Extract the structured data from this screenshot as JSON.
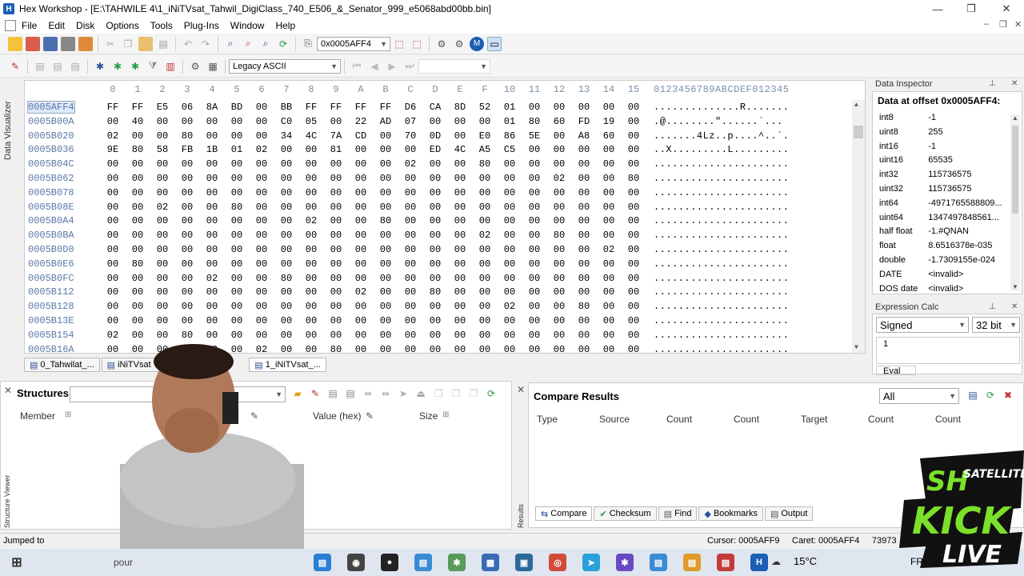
{
  "window": {
    "title": "Hex Workshop - [E:\\TAHWILE 4\\1_iNiTVsat_Tahwil_DigiClass_740_E506_&_Senator_999_e5068abd00bb.bin]",
    "minimize": "—",
    "restore": "❐",
    "close": "✕"
  },
  "menu": [
    "File",
    "Edit",
    "Disk",
    "Options",
    "Tools",
    "Plug-Ins",
    "Window",
    "Help"
  ],
  "toolbar": {
    "goto_value": "0x0005AFF4",
    "charset": "Legacy ASCII"
  },
  "sidebar_left": {
    "label": "Data Visualizer"
  },
  "hex": {
    "header": [
      "0",
      "1",
      "2",
      "3",
      "4",
      "5",
      "6",
      "7",
      "8",
      "9",
      "A",
      "B",
      "C",
      "D",
      "E",
      "F",
      "10",
      "11",
      "12",
      "13",
      "14",
      "15"
    ],
    "ascii_header": "0123456789ABCDEF012345",
    "rows": [
      {
        "offset": "0005AFF4",
        "bytes": [
          "FF",
          "FF",
          "E5",
          "06",
          "8A",
          "BD",
          "00",
          "BB",
          "FF",
          "FF",
          "FF",
          "FF",
          "D6",
          "CA",
          "8D",
          "52",
          "01",
          "00",
          "00",
          "00",
          "00",
          "00"
        ],
        "ascii": "..............R......."
      },
      {
        "offset": "0005B00A",
        "bytes": [
          "00",
          "40",
          "00",
          "00",
          "00",
          "00",
          "00",
          "C0",
          "05",
          "00",
          "22",
          "AD",
          "07",
          "00",
          "00",
          "00",
          "01",
          "80",
          "60",
          "FD",
          "19",
          "00"
        ],
        "ascii": ".@........\"......`..."
      },
      {
        "offset": "0005B020",
        "bytes": [
          "02",
          "00",
          "00",
          "80",
          "00",
          "00",
          "00",
          "34",
          "4C",
          "7A",
          "CD",
          "00",
          "70",
          "0D",
          "00",
          "E0",
          "86",
          "5E",
          "00",
          "A8",
          "60",
          "00"
        ],
        "ascii": ".......4Lz..p....^..`."
      },
      {
        "offset": "0005B036",
        "bytes": [
          "9E",
          "80",
          "58",
          "FB",
          "1B",
          "01",
          "02",
          "00",
          "00",
          "81",
          "00",
          "00",
          "00",
          "ED",
          "4C",
          "A5",
          "C5",
          "00",
          "00",
          "00",
          "00",
          "00"
        ],
        "ascii": "..X.........L........."
      },
      {
        "offset": "0005B04C",
        "bytes": [
          "00",
          "00",
          "00",
          "00",
          "00",
          "00",
          "00",
          "00",
          "00",
          "00",
          "00",
          "00",
          "02",
          "00",
          "00",
          "80",
          "00",
          "00",
          "00",
          "00",
          "00",
          "00"
        ],
        "ascii": "......................"
      },
      {
        "offset": "0005B062",
        "bytes": [
          "00",
          "00",
          "00",
          "00",
          "00",
          "00",
          "00",
          "00",
          "00",
          "00",
          "00",
          "00",
          "00",
          "00",
          "00",
          "00",
          "00",
          "00",
          "02",
          "00",
          "00",
          "80"
        ],
        "ascii": "......................"
      },
      {
        "offset": "0005B078",
        "bytes": [
          "00",
          "00",
          "00",
          "00",
          "00",
          "00",
          "00",
          "00",
          "00",
          "00",
          "00",
          "00",
          "00",
          "00",
          "00",
          "00",
          "00",
          "00",
          "00",
          "00",
          "00",
          "00"
        ],
        "ascii": "......................"
      },
      {
        "offset": "0005B08E",
        "bytes": [
          "00",
          "00",
          "02",
          "00",
          "00",
          "80",
          "00",
          "00",
          "00",
          "00",
          "00",
          "00",
          "00",
          "00",
          "00",
          "00",
          "00",
          "00",
          "00",
          "00",
          "00",
          "00"
        ],
        "ascii": "......................"
      },
      {
        "offset": "0005B0A4",
        "bytes": [
          "00",
          "00",
          "00",
          "00",
          "00",
          "00",
          "00",
          "00",
          "02",
          "00",
          "00",
          "80",
          "00",
          "00",
          "00",
          "00",
          "00",
          "00",
          "00",
          "00",
          "00",
          "00"
        ],
        "ascii": "......................"
      },
      {
        "offset": "0005B0BA",
        "bytes": [
          "00",
          "00",
          "00",
          "00",
          "00",
          "00",
          "00",
          "00",
          "00",
          "00",
          "00",
          "00",
          "00",
          "00",
          "00",
          "02",
          "00",
          "00",
          "80",
          "00",
          "00",
          "00"
        ],
        "ascii": "......................"
      },
      {
        "offset": "0005B0D0",
        "bytes": [
          "00",
          "00",
          "00",
          "00",
          "00",
          "00",
          "00",
          "00",
          "00",
          "00",
          "00",
          "00",
          "00",
          "00",
          "00",
          "00",
          "00",
          "00",
          "00",
          "00",
          "02",
          "00"
        ],
        "ascii": "......................"
      },
      {
        "offset": "0005B0E6",
        "bytes": [
          "00",
          "80",
          "00",
          "00",
          "00",
          "00",
          "00",
          "00",
          "00",
          "00",
          "00",
          "00",
          "00",
          "00",
          "00",
          "00",
          "00",
          "00",
          "00",
          "00",
          "00",
          "00"
        ],
        "ascii": "......................"
      },
      {
        "offset": "0005B0FC",
        "bytes": [
          "00",
          "00",
          "00",
          "00",
          "02",
          "00",
          "00",
          "80",
          "00",
          "00",
          "00",
          "00",
          "00",
          "00",
          "00",
          "00",
          "00",
          "00",
          "00",
          "00",
          "00",
          "00"
        ],
        "ascii": "......................"
      },
      {
        "offset": "0005B112",
        "bytes": [
          "00",
          "00",
          "00",
          "00",
          "00",
          "00",
          "00",
          "00",
          "00",
          "00",
          "02",
          "00",
          "00",
          "80",
          "00",
          "00",
          "00",
          "00",
          "00",
          "00",
          "00",
          "00"
        ],
        "ascii": "......................"
      },
      {
        "offset": "0005B128",
        "bytes": [
          "00",
          "00",
          "00",
          "00",
          "00",
          "00",
          "00",
          "00",
          "00",
          "00",
          "00",
          "00",
          "00",
          "00",
          "00",
          "00",
          "02",
          "00",
          "00",
          "80",
          "00",
          "00"
        ],
        "ascii": "......................"
      },
      {
        "offset": "0005B13E",
        "bytes": [
          "00",
          "00",
          "00",
          "00",
          "00",
          "00",
          "00",
          "00",
          "00",
          "00",
          "00",
          "00",
          "00",
          "00",
          "00",
          "00",
          "00",
          "00",
          "00",
          "00",
          "00",
          "00"
        ],
        "ascii": "......................"
      },
      {
        "offset": "0005B154",
        "bytes": [
          "02",
          "00",
          "00",
          "80",
          "00",
          "00",
          "00",
          "00",
          "00",
          "00",
          "00",
          "00",
          "00",
          "00",
          "00",
          "00",
          "00",
          "00",
          "00",
          "00",
          "00",
          "00"
        ],
        "ascii": "......................"
      },
      {
        "offset": "0005B16A",
        "bytes": [
          "00",
          "00",
          "00",
          "00",
          "00",
          "00",
          "02",
          "00",
          "00",
          "80",
          "00",
          "00",
          "00",
          "00",
          "00",
          "00",
          "00",
          "00",
          "00",
          "00",
          "00",
          "00"
        ],
        "ascii": "......................"
      }
    ]
  },
  "doc_tabs": [
    "0_Tahwilat_...",
    "iNiTVsat Ta...",
    "1_iNiTVsat_..."
  ],
  "data_inspector": {
    "title": "Data Inspector",
    "heading": "Data at offset 0x0005AFF4:",
    "rows": [
      {
        "k": "int8",
        "v": "-1"
      },
      {
        "k": "uint8",
        "v": "255"
      },
      {
        "k": "int16",
        "v": "-1"
      },
      {
        "k": "uint16",
        "v": "65535"
      },
      {
        "k": "int32",
        "v": "115736575"
      },
      {
        "k": "uint32",
        "v": "115736575"
      },
      {
        "k": "int64",
        "v": "-4971765588809..."
      },
      {
        "k": "uint64",
        "v": "1347497848561..."
      },
      {
        "k": "half float",
        "v": "-1.#QNAN"
      },
      {
        "k": "float",
        "v": "8.6516378e-035"
      },
      {
        "k": "double",
        "v": "-1.7309155e-024"
      },
      {
        "k": "DATE",
        "v": "<invalid>"
      },
      {
        "k": "DOS date",
        "v": "<invalid>"
      }
    ]
  },
  "expression_calc": {
    "title": "Expression Calc",
    "signed": "Signed",
    "bits": "32 bit",
    "line": "1",
    "eval_label": "Eval"
  },
  "structures": {
    "title": "Structures",
    "columns": [
      "Member",
      "Value (hex)",
      "Size"
    ],
    "side_label": "Structure Viewer"
  },
  "compare": {
    "title": "Compare Results",
    "filter": "All",
    "columns": [
      "Type",
      "Source",
      "Count",
      "Count",
      "Target",
      "Count",
      "Count"
    ],
    "tabs": [
      "Compare",
      "Checksum",
      "Find",
      "Bookmarks",
      "Output"
    ],
    "side_label": "Results"
  },
  "status": {
    "left": "Jumped to",
    "cursor": "Cursor: 0005AFF9",
    "caret": "Caret: 0005AFF4",
    "size": "73973"
  },
  "taskbar": {
    "temp": "15°C",
    "lang": "FRA",
    "search_hint": "pour"
  },
  "overlay": {
    "line1": "SH",
    "line2": "SATELLITE",
    "line3": "KICK",
    "line4": "LIVE"
  },
  "colors": {
    "accent": "#1a5fb4",
    "offset": "#5a78a8",
    "logo_green": "#7be02a"
  }
}
